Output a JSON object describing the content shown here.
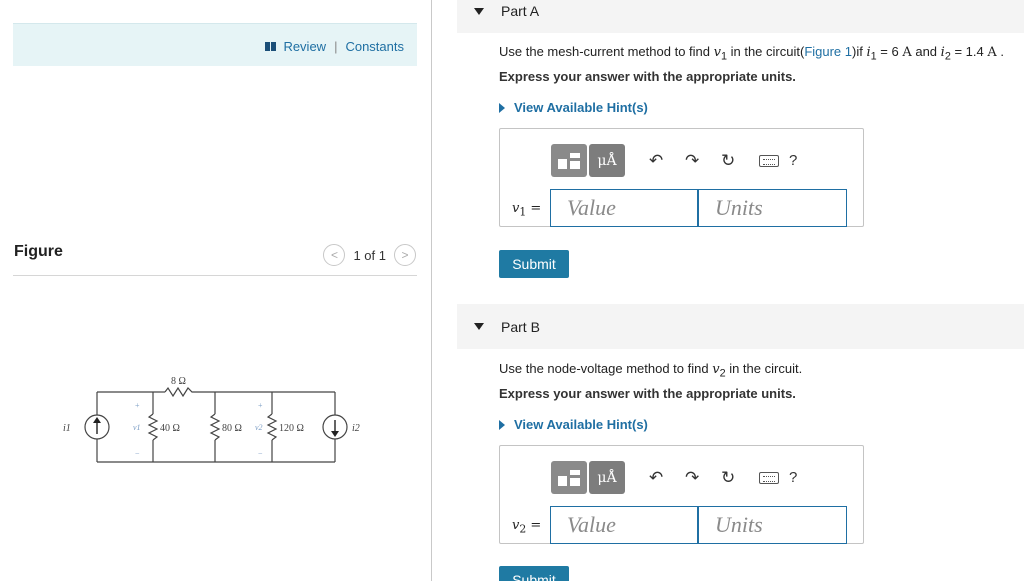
{
  "left": {
    "review_label": "Review",
    "separator": "|",
    "constants_label": "Constants",
    "figure_label": "Figure",
    "pager": {
      "prev": "<",
      "count": "1 of 1",
      "next": ">"
    },
    "circuit": {
      "source1": "i1",
      "source2": "i2",
      "r_top": "8 Ω",
      "r1": "40 Ω",
      "r2": "80 Ω",
      "r3": "120 Ω",
      "v1": "v1",
      "v2": "v2",
      "plus": "+",
      "minus": "−"
    }
  },
  "partA": {
    "title": "Part A",
    "question_pre": "Use the mesh-current method to find ",
    "question_var": "v",
    "question_sub": "1",
    "question_mid": " in the circuit(",
    "figure_link": "Figure 1",
    "question_post": ")if ",
    "i1_text": "i",
    "i1_sub": "1",
    "i1_val": " = 6 ",
    "unit_a": "A",
    "and_text": " and ",
    "i2_text": "i",
    "i2_sub": "2",
    "i2_val": " = 1.4 ",
    "unit_b": "A",
    "end": " .",
    "instruction": "Express your answer with the appropriate units.",
    "hint": "View Available Hint(s)",
    "var_label": "v",
    "var_sub": "1",
    "equals": " =",
    "value_placeholder": "Value",
    "units_placeholder": "Units",
    "submit": "Submit"
  },
  "partB": {
    "title": "Part B",
    "question_pre": "Use the node-voltage method to find ",
    "question_var": "v",
    "question_sub": "2",
    "question_post": " in the circuit.",
    "instruction": "Express your answer with the appropriate units.",
    "hint": "View Available Hint(s)",
    "var_label": "v",
    "var_sub": "2",
    "equals": " =",
    "value_placeholder": "Value",
    "units_placeholder": "Units",
    "submit": "Submit"
  },
  "toolbar": {
    "units_glyph": "μÅ",
    "undo": "↶",
    "redo": "↷",
    "reset": "↻",
    "help": "?"
  },
  "colors": {
    "accent": "#1f6fa3",
    "submit": "#1f7aa3",
    "topbar": "#e6f4f6"
  }
}
